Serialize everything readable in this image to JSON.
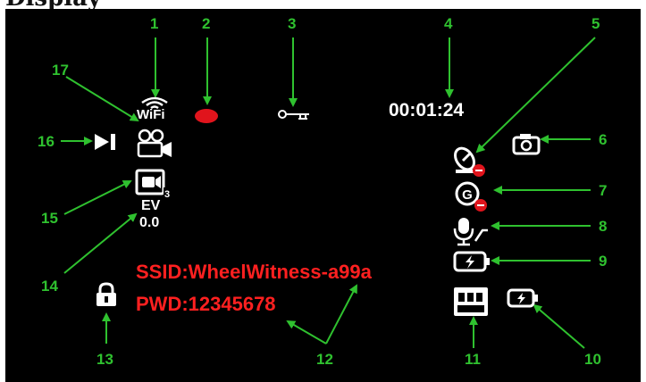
{
  "page_title": "Display",
  "screen": {
    "wifi_label": "WiFi",
    "timer": "00:01:24",
    "ev_label": "EV",
    "ev_value": "0.0",
    "ssid": "SSID:WheelWitness-a99a",
    "password": "PWD:12345678"
  },
  "callouts": [
    "1",
    "2",
    "3",
    "4",
    "5",
    "6",
    "7",
    "8",
    "9",
    "10",
    "11",
    "12",
    "13",
    "14",
    "15",
    "16",
    "17"
  ],
  "colors": {
    "callout": "#2fc12f",
    "credentials": "#ff2020",
    "icon": "#ffffff",
    "recording_dot": "#e0141c",
    "disabled_badge": "#e0141c"
  },
  "icons": [
    "wifi-icon",
    "recording-dot-icon",
    "key-icon",
    "gps-disabled-icon",
    "photo-camera-icon",
    "g-sensor-disabled-icon",
    "microphone-icon",
    "charging-battery-icon",
    "parking-battery-icon",
    "memory-card-icon",
    "padlock-icon",
    "exposure-value-icon",
    "photo-burst-icon",
    "video-camera-icon",
    "play-icon"
  ]
}
